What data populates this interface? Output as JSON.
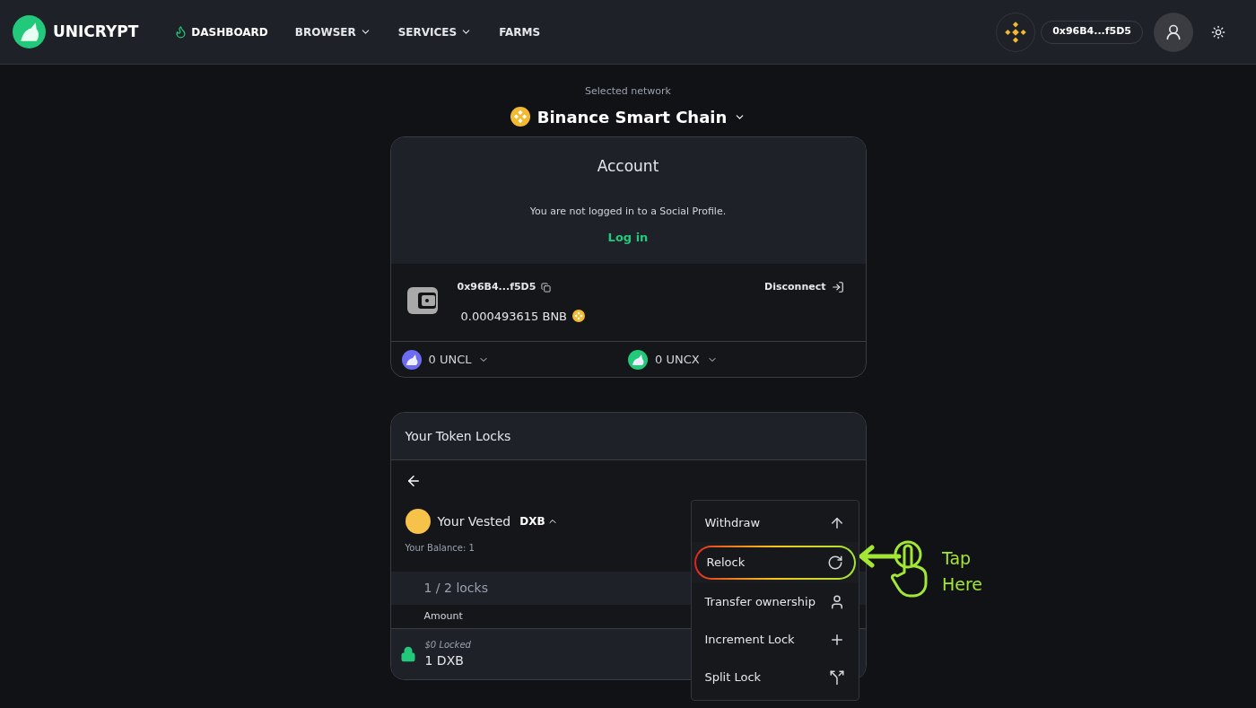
{
  "header": {
    "logo_text": "UNICRYPT",
    "nav": [
      {
        "label": "DASHBOARD",
        "selected": true,
        "kind": "link"
      },
      {
        "label": "BROWSER",
        "selected": false,
        "kind": "dropdown"
      },
      {
        "label": "SERVICES",
        "selected": false,
        "kind": "dropdown"
      },
      {
        "label": "FARMS",
        "selected": false,
        "kind": "link"
      }
    ],
    "wallet_address": "0x96B4...f5D5"
  },
  "network": {
    "caption": "Selected network",
    "name": "Binance Smart Chain"
  },
  "account": {
    "title": "Account",
    "message": "You are not logged in to a Social Profile.",
    "login_link": "Log in",
    "address": "0x96B4...f5D5",
    "balance": "0.000493615 BNB",
    "disconnect": "Disconnect",
    "tokens": [
      {
        "label": "0 UNCL",
        "kind": "uncl"
      },
      {
        "label": "0 UNCX",
        "kind": "uncx"
      }
    ]
  },
  "locks": {
    "title": "Your Token Locks",
    "token_prefix": "Your Vested",
    "token": "DXB",
    "balance": "Your Balance: 1",
    "count": "1 / 2 locks",
    "column": "Amount",
    "row": {
      "value_locked": "$0 Locked",
      "amount": "1 DXB"
    }
  },
  "menu": {
    "items": [
      {
        "label": "Withdraw",
        "kind": "withdraw",
        "selected": false
      },
      {
        "label": "Relock",
        "kind": "relock",
        "selected": true
      },
      {
        "label": "Transfer ownership",
        "kind": "transfer",
        "selected": false
      },
      {
        "label": "Increment Lock",
        "kind": "increment",
        "selected": false
      },
      {
        "label": "Split Lock",
        "kind": "split",
        "selected": false
      }
    ]
  },
  "annotation": {
    "lines": [
      "Tap",
      "Here"
    ]
  }
}
